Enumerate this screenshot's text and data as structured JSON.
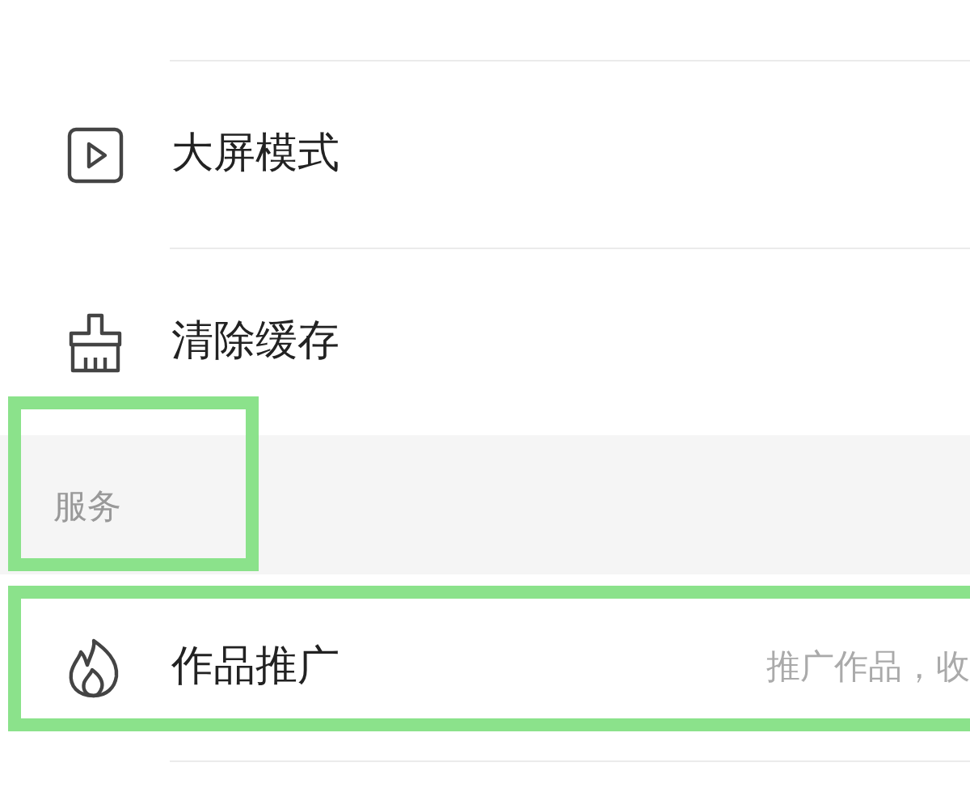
{
  "settings_rows": [
    {
      "kind": "play",
      "label": "大屏模式"
    },
    {
      "kind": "brush",
      "label": "清除缓存"
    }
  ],
  "section": {
    "title": "服务"
  },
  "service_rows": [
    {
      "kind": "fire",
      "label": "作品推广",
      "detail": "推广作品，收"
    }
  ]
}
